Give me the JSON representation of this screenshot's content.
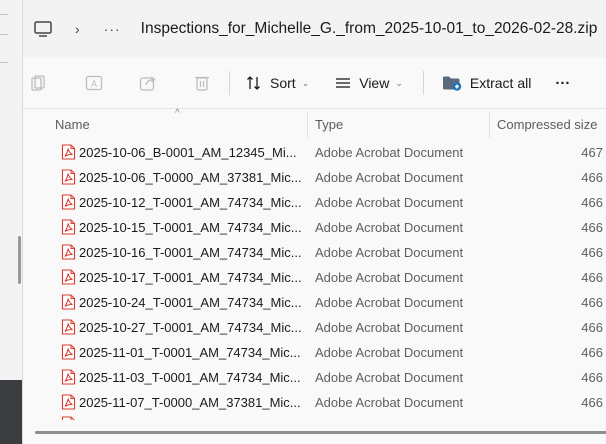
{
  "address_bar": {
    "separator": "›",
    "overflow": "···",
    "current_folder": "Inspections_for_Michelle_G._from_2025-10-01_to_2026-02-28.zip"
  },
  "toolbar": {
    "sort_label": "Sort",
    "view_label": "View",
    "extract_label": "Extract all",
    "more_label": "···",
    "chevron": "⌄"
  },
  "columns": {
    "name": "Name",
    "type": "Type",
    "compressed_size": "Compressed size",
    "sort_indicator": "^"
  },
  "files": [
    {
      "name": "2025-10-06_B-0001_AM_12345_Mi...",
      "type": "Adobe Acrobat Document",
      "size": "467"
    },
    {
      "name": "2025-10-06_T-0000_AM_37381_Mic...",
      "type": "Adobe Acrobat Document",
      "size": "466"
    },
    {
      "name": "2025-10-12_T-0001_AM_74734_Mic...",
      "type": "Adobe Acrobat Document",
      "size": "466"
    },
    {
      "name": "2025-10-15_T-0001_AM_74734_Mic...",
      "type": "Adobe Acrobat Document",
      "size": "466"
    },
    {
      "name": "2025-10-16_T-0001_AM_74734_Mic...",
      "type": "Adobe Acrobat Document",
      "size": "466"
    },
    {
      "name": "2025-10-17_T-0001_AM_74734_Mic...",
      "type": "Adobe Acrobat Document",
      "size": "466"
    },
    {
      "name": "2025-10-24_T-0001_AM_74734_Mic...",
      "type": "Adobe Acrobat Document",
      "size": "466"
    },
    {
      "name": "2025-10-27_T-0001_AM_74734_Mic...",
      "type": "Adobe Acrobat Document",
      "size": "466"
    },
    {
      "name": "2025-11-01_T-0001_AM_74734_Mic...",
      "type": "Adobe Acrobat Document",
      "size": "466"
    },
    {
      "name": "2025-11-03_T-0001_AM_74734_Mic...",
      "type": "Adobe Acrobat Document",
      "size": "466"
    },
    {
      "name": "2025-11-07_T-0000_AM_37381_Mic...",
      "type": "Adobe Acrobat Document",
      "size": "466"
    }
  ],
  "colors": {
    "pdf_red": "#d83b2d",
    "extract_accent": "#1a73b8"
  }
}
